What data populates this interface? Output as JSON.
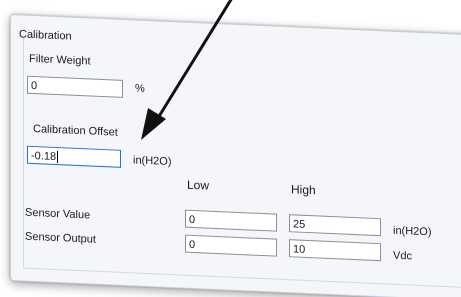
{
  "group_title": "Calibration",
  "filter_weight": {
    "label": "Filter Weight",
    "value": "0",
    "unit": "%"
  },
  "calibration_offset": {
    "label": "Calibration Offset",
    "value": "-0.18",
    "unit": "in(H2O)"
  },
  "columns": {
    "low": "Low",
    "high": "High"
  },
  "sensor_value": {
    "label": "Sensor Value",
    "low": "0",
    "high": "25",
    "unit": "in(H2O)"
  },
  "sensor_output": {
    "label": "Sensor Output",
    "low": "0",
    "high": "10",
    "unit": "Vdc"
  },
  "colors": {
    "panel_bg": "#f4f6fa",
    "active_border": "#2b6fd6",
    "arrow": "#111111"
  }
}
